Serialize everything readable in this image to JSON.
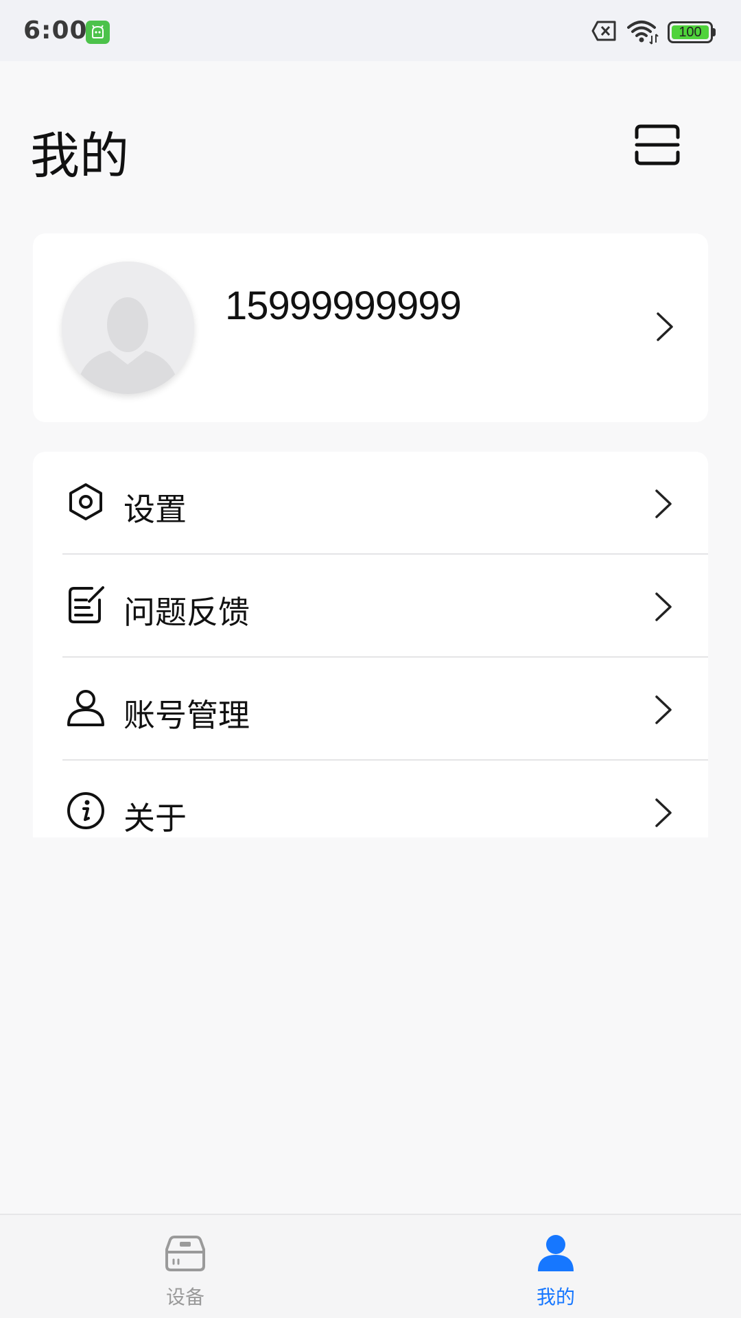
{
  "status_bar": {
    "time": "6:00",
    "battery": "100",
    "icons": [
      "app-notification-icon",
      "no-sim-icon",
      "wifi-icon",
      "battery-icon"
    ]
  },
  "header": {
    "title": "我的",
    "scan_icon": "scan-icon"
  },
  "profile": {
    "phone": "15999999999",
    "avatar_icon": "default-avatar-icon"
  },
  "menu": {
    "items": [
      {
        "label": "设置",
        "icon": "settings-hexagon-icon"
      },
      {
        "label": "问题反馈",
        "icon": "feedback-edit-icon"
      },
      {
        "label": "账号管理",
        "icon": "user-icon"
      },
      {
        "label": "关于",
        "icon": "info-icon"
      }
    ]
  },
  "tabs": [
    {
      "label": "设备",
      "icon": "device-icon",
      "active": false
    },
    {
      "label": "我的",
      "icon": "person-icon",
      "active": true
    }
  ],
  "colors": {
    "accent": "#1677ff",
    "tab_inactive": "#9a9a9a",
    "background": "#f8f8f9",
    "card": "#ffffff"
  }
}
